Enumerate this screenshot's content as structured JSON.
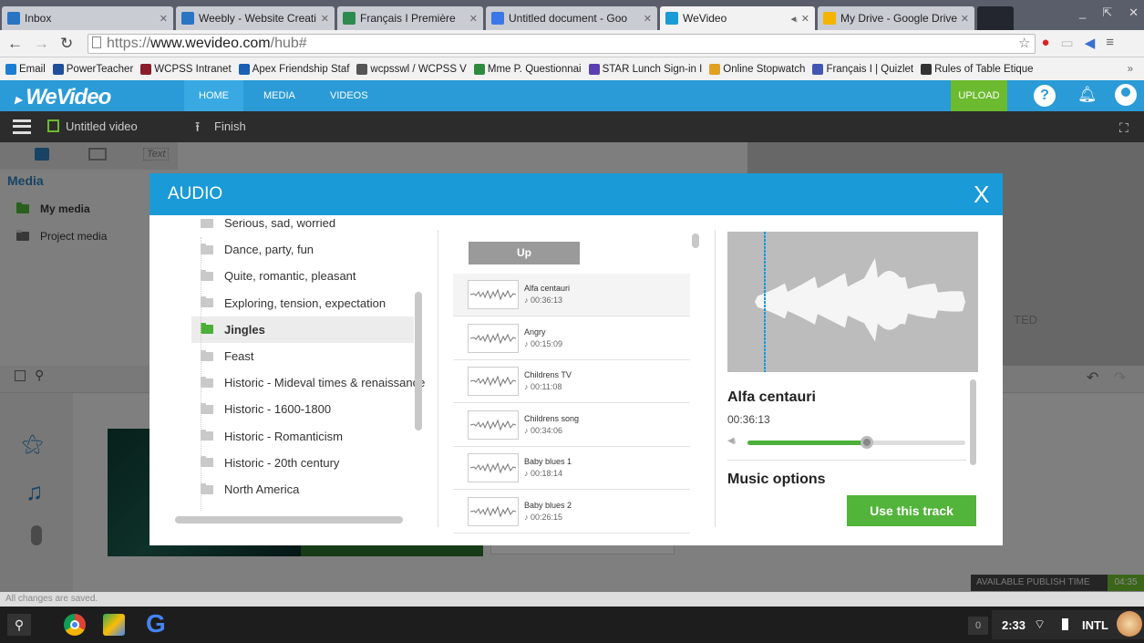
{
  "browser": {
    "tabs": [
      {
        "title": "Inbox",
        "favicon_color": "#2a74c4"
      },
      {
        "title": "Weebly - Website Creati",
        "favicon_color": "#2a74c4"
      },
      {
        "title": "Français I Première",
        "favicon_color": "#2f8a4f"
      },
      {
        "title": "Untitled document - Goo",
        "favicon_color": "#3b78e7"
      },
      {
        "title": "WeVideo",
        "favicon_color": "#1a9ad6"
      },
      {
        "title": "My Drive - Google Drive",
        "favicon_color": "#f4b400"
      }
    ],
    "url_prefix": "https://",
    "url_domain": "www.wevideo.com",
    "url_path": "/hub#",
    "bookmarks": [
      {
        "label": "Email",
        "color": "#1a7fd4"
      },
      {
        "label": "PowerTeacher",
        "color": "#1f4f9a"
      },
      {
        "label": "WCPSS Intranet",
        "color": "#8a1c2c"
      },
      {
        "label": "Apex Friendship Staf",
        "color": "#1a5fb4"
      },
      {
        "label": "wcpsswl / WCPSS V",
        "color": "#555555"
      },
      {
        "label": "Mme P. Questionnai",
        "color": "#2e8b3d"
      },
      {
        "label": "STAR Lunch Sign-in I",
        "color": "#5a3fb0"
      },
      {
        "label": "Online Stopwatch",
        "color": "#e0a020"
      },
      {
        "label": "Français I | Quizlet",
        "color": "#4257b2"
      },
      {
        "label": "Rules of Table Etique",
        "color": "#333333"
      }
    ]
  },
  "app": {
    "logo": "WeVideo",
    "nav": [
      "HOME",
      "MEDIA",
      "VIDEOS"
    ],
    "upload_label": "UPLOAD",
    "project_title": "Untitled video",
    "finish_label": "Finish",
    "media_header": "Media",
    "text_tab": "Text",
    "media_items": [
      "My media",
      "Project media"
    ],
    "status_text": "All changes are saved.",
    "publish_label": "AVAILABLE PUBLISH TIME",
    "publish_time": "04:35",
    "bg_text": "TED"
  },
  "modal": {
    "title": "AUDIO",
    "close": "X",
    "categories": [
      "Serious, sad, worried",
      "Dance, party, fun",
      "Quite, romantic, pleasant",
      "Exploring, tension, expectation",
      "Jingles",
      "Feast",
      "Historic - Mideval times & renaissance",
      "Historic - 1600-1800",
      "Historic - Romanticism",
      "Historic - 20th century",
      "North America"
    ],
    "selected_category": "Jingles",
    "up_label": "Up",
    "tracks": [
      {
        "name": "Alfa centauri",
        "duration": "00:36:13"
      },
      {
        "name": "Angry",
        "duration": "00:15:09"
      },
      {
        "name": "Childrens TV",
        "duration": "00:11:08"
      },
      {
        "name": "Childrens song",
        "duration": "00:34:06"
      },
      {
        "name": "Baby blues 1",
        "duration": "00:18:14"
      },
      {
        "name": "Baby blues 2",
        "duration": "00:26:15"
      }
    ],
    "preview": {
      "title": "Alfa centauri",
      "duration": "00:36:13",
      "volume": 0.55,
      "music_options": "Music options",
      "use_track": "Use this track"
    }
  },
  "taskbar": {
    "notif_count": "0",
    "time": "2:33",
    "ime": "INTL"
  },
  "colors": {
    "brand_blue": "#1a9ad6",
    "brand_green": "#6cba2f",
    "use_track_green": "#52b43a"
  }
}
